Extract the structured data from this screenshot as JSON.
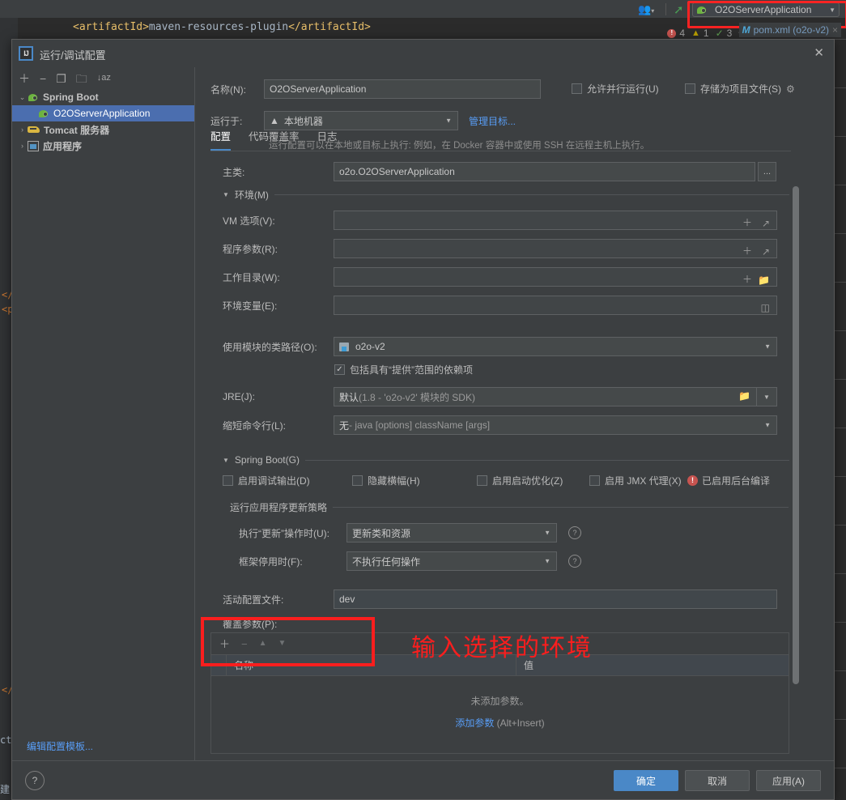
{
  "ide": {
    "code_line": "<artifactId>maven-resources-plugin</artifactId>",
    "code_frag_1": "</",
    "code_frag_2": "<p",
    "code_frag_3": "</",
    "code_frag_4": "ct",
    "code_frag_5": "建",
    "run_config_name": "O2OServerApplication",
    "run_config_caret": "▼",
    "people_icon": "people-icon",
    "status": {
      "error_count": "4",
      "warning_count": "1",
      "ok_count": "3",
      "up_arrow": "^",
      "down_arrow": "v"
    },
    "tab": {
      "m_icon": "M",
      "label": "pom.xml (o2o-v2)",
      "close": "×"
    }
  },
  "dialog": {
    "title": "运行/调试配置",
    "icon_text": "IJ",
    "close_label": "✕"
  },
  "sidebar": {
    "toolbar": [
      {
        "name": "add-configuration-button",
        "glyph": "＋"
      },
      {
        "name": "remove-configuration-button",
        "glyph": "−"
      },
      {
        "name": "copy-configuration-button",
        "glyph": "❐"
      },
      {
        "name": "new-folder-button",
        "glyph": "🗀"
      },
      {
        "name": "sort-configurations-button",
        "glyph": "↓az"
      }
    ],
    "tree": [
      {
        "label": "Spring Boot",
        "type": "group",
        "twisty": "⌄",
        "icon": "spring-boot-icon",
        "selected": false
      },
      {
        "label": "O2OServerApplication",
        "type": "leaf",
        "twisty": "",
        "icon": "spring-boot-icon",
        "selected": true
      },
      {
        "label": "Tomcat 服务器",
        "type": "group",
        "twisty": "›",
        "icon": "tomcat-icon",
        "selected": false
      },
      {
        "label": "应用程序",
        "type": "group",
        "twisty": "›",
        "icon": "application-icon",
        "selected": false
      }
    ],
    "edit_templates_link": "编辑配置模板..."
  },
  "main": {
    "name_label": "名称(N):",
    "name_value": "O2OServerApplication",
    "allow_parallel_label": "允许并行运行(U)",
    "allow_parallel_checked": false,
    "store_as_project_label": "存储为项目文件(S)",
    "store_as_project_checked": false,
    "gear_icon": "gear-icon",
    "run_on_label": "运行于:",
    "run_on_value": "本地机器",
    "manage_targets_link": "管理目标...",
    "run_on_hint": "运行配置可以在本地或目标上执行: 例如，在 Docker 容器中或使用 SSH 在远程主机上执行。",
    "tabs": [
      {
        "label": "配置",
        "active": true
      },
      {
        "label": "代码覆盖率",
        "active": false
      },
      {
        "label": "日志",
        "active": false
      }
    ],
    "main_class_label": "主类:",
    "main_class_value": "o2o.O2OServerApplication",
    "main_class_browse": "...",
    "env_section_title": "环境(M)",
    "vm_options_label": "VM 选项(V):",
    "vm_options_value": "",
    "program_args_label": "程序参数(R):",
    "program_args_value": "",
    "working_dir_label": "工作目录(W):",
    "working_dir_value": "",
    "env_vars_label": "环境变量(E):",
    "env_vars_value": "",
    "module_classpath_label": "使用模块的类路径(O):",
    "module_classpath_value": "o2o-v2",
    "include_provided_label": "包括具有“提供”范围的依赖项",
    "include_provided_checked": true,
    "jre_label": "JRE(J):",
    "jre_value_bold": "默认",
    "jre_value_rest": " (1.8 - 'o2o-v2' 模块的 SDK)",
    "shorten_cmd_label": "缩短命令行(L):",
    "shorten_cmd_value_bold": "无",
    "shorten_cmd_value_rest": " - java [options] className [args]",
    "spring_boot_section_title": "Spring Boot(G)",
    "spring_checkboxes": [
      {
        "label": "启用调试输出(D)",
        "checked": false
      },
      {
        "label": "隐藏横幅(H)",
        "checked": false
      },
      {
        "label": "启用启动优化(Z)",
        "checked": false
      },
      {
        "label": "启用 JMX 代理(X)",
        "checked": false
      }
    ],
    "background_compile_warning": "已启用后台编译",
    "update_policy_section_title": "运行应用程序更新策略",
    "on_update_label": "执行“更新”操作时(U):",
    "on_update_value": "更新类和资源",
    "on_frame_deactivate_label": "框架停用时(F):",
    "on_frame_deactivate_value": "不执行任何操作",
    "active_profiles_label": "活动配置文件:",
    "active_profiles_value": "dev",
    "override_params_label": "覆盖参数(P):",
    "params_toolbar": [
      {
        "name": "add-param-button",
        "glyph": "＋",
        "dim": false
      },
      {
        "name": "remove-param-button",
        "glyph": "−",
        "dim": true
      },
      {
        "name": "move-param-up-button",
        "glyph": "▲",
        "dim": true
      },
      {
        "name": "move-param-down-button",
        "glyph": "▼",
        "dim": true
      }
    ],
    "params_columns": [
      "名称",
      "值"
    ],
    "params_empty_text": "未添加参数。",
    "params_add_link": "添加参数",
    "params_add_shortcut": " (Alt+Insert)"
  },
  "footer": {
    "help_glyph": "?",
    "ok_label": "确定",
    "cancel_label": "取消",
    "apply_label": "应用(A)"
  },
  "annotation": {
    "text": "输入选择的环境",
    "color": "#fa1e1e"
  },
  "colors": {
    "accent_blue": "#4a88c7",
    "link_blue": "#589df6",
    "selection_blue": "#4b6eaf",
    "panel_bg": "#3c3f41",
    "editor_bg": "#2b2b2b",
    "field_bg": "#45494a",
    "annotation_red": "#fa1e1e",
    "error_red": "#c75450",
    "spring_green": "#6cb33f"
  }
}
